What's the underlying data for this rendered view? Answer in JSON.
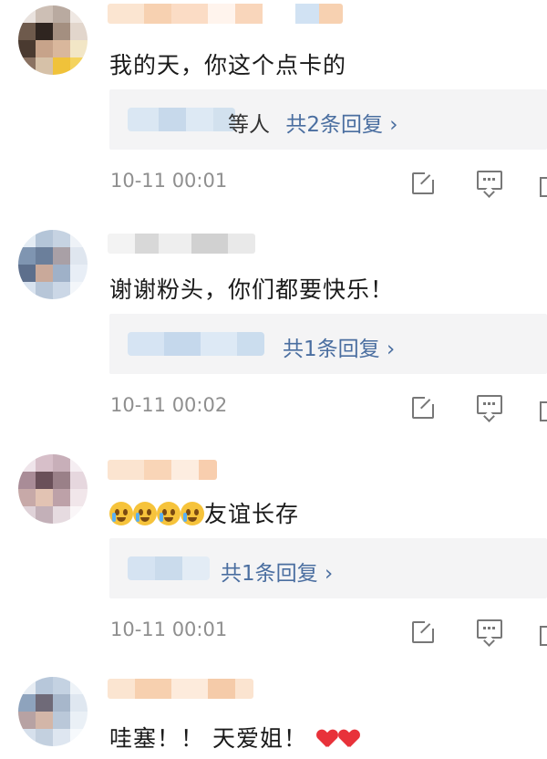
{
  "comments": [
    {
      "text": "我的天，你这个点卡的",
      "reply_prefix": "等人",
      "reply_link": "共2条回复 ›",
      "time": "10-11 00:01"
    },
    {
      "text": "谢谢粉头，你们都要快乐！",
      "reply_prefix": "",
      "reply_link": "共1条回复 ›",
      "time": "10-11 00:02"
    },
    {
      "text_suffix": "友谊长存",
      "emoji_count": 4,
      "emoji_name": "crying-face",
      "reply_prefix": "",
      "reply_link": "共1条回复 ›",
      "time": "10-11 00:01"
    },
    {
      "text": "哇塞！！ 天爱姐！",
      "emoji_name": "red-heart",
      "emoji_count": 2
    }
  ],
  "icons": {
    "share": "share-icon",
    "comment": "comment-icon",
    "like": "like-icon"
  },
  "colors": {
    "link": "#4a6ea0",
    "time": "#8f8f8f",
    "reply_bg": "#f4f4f5"
  }
}
